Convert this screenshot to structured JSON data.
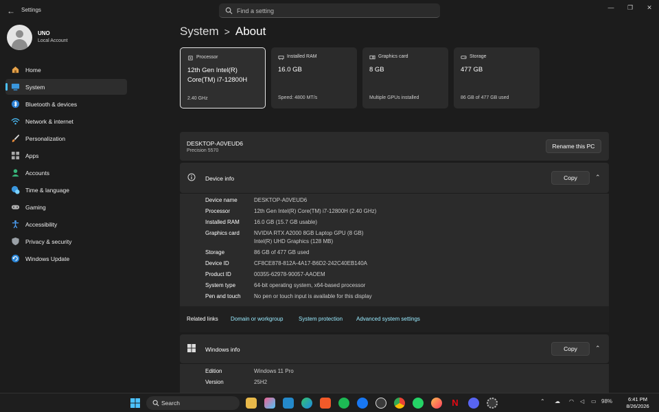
{
  "window": {
    "title": "Settings"
  },
  "search": {
    "placeholder": "Find a setting"
  },
  "user": {
    "name": "UNO",
    "account_type": "Local Account"
  },
  "sidebar": {
    "items": [
      {
        "label": "Home",
        "icon": "home-icon",
        "active": false
      },
      {
        "label": "System",
        "icon": "system-icon",
        "active": true
      },
      {
        "label": "Bluetooth & devices",
        "icon": "bluetooth-icon",
        "active": false
      },
      {
        "label": "Network & internet",
        "icon": "wifi-icon",
        "active": false
      },
      {
        "label": "Personalization",
        "icon": "brush-icon",
        "active": false
      },
      {
        "label": "Apps",
        "icon": "apps-icon",
        "active": false
      },
      {
        "label": "Accounts",
        "icon": "accounts-icon",
        "active": false
      },
      {
        "label": "Time & language",
        "icon": "globe-clock-icon",
        "active": false
      },
      {
        "label": "Gaming",
        "icon": "gamepad-icon",
        "active": false
      },
      {
        "label": "Accessibility",
        "icon": "accessibility-icon",
        "active": false
      },
      {
        "label": "Privacy & security",
        "icon": "shield-icon",
        "active": false
      },
      {
        "label": "Windows Update",
        "icon": "update-icon",
        "active": false
      }
    ]
  },
  "breadcrumb": {
    "parent": "System",
    "separator": ">",
    "current": "About"
  },
  "specs": [
    {
      "title": "Processor",
      "value": "12th Gen Intel(R) Core(TM) i7-12800H",
      "detail": "2.40 GHz",
      "icon": "processor-icon"
    },
    {
      "title": "Installed RAM",
      "value": "16.0 GB",
      "detail": "Speed: 4800 MT/s",
      "icon": "ram-icon"
    },
    {
      "title": "Graphics card",
      "value": "8 GB",
      "detail": "Multiple GPUs installed",
      "icon": "gpu-icon"
    },
    {
      "title": "Storage",
      "value": "477 GB",
      "detail": "86 GB of 477 GB used",
      "icon": "storage-icon"
    }
  ],
  "pc": {
    "name": "DESKTOP-A0VEUD6",
    "model": "Precision 5570",
    "rename_label": "Rename this PC"
  },
  "device_info": {
    "title": "Device info",
    "copy_label": "Copy",
    "rows": [
      {
        "key": "Device name",
        "value": "DESKTOP-A0VEUD6"
      },
      {
        "key": "Processor",
        "value": "12th Gen Intel(R) Core(TM) i7-12800H (2.40 GHz)"
      },
      {
        "key": "Installed RAM",
        "value": "16.0 GB (15.7 GB usable)"
      },
      {
        "key": "Graphics card",
        "value": "NVIDIA RTX A2000 8GB Laptop GPU (8 GB)",
        "value2": "Intel(R) UHD Graphics (128 MB)"
      },
      {
        "key": "Storage",
        "value": "86 GB of 477 GB used"
      },
      {
        "key": "Device ID",
        "value": "CF8CE878-812A-4A17-B6D2-242C40EB140A"
      },
      {
        "key": "Product ID",
        "value": "00355-62978-90057-AAOEM"
      },
      {
        "key": "System type",
        "value": "64-bit operating system, x64-based processor"
      },
      {
        "key": "Pen and touch",
        "value": "No pen or touch input is available for this display"
      }
    ]
  },
  "related": {
    "label": "Related links",
    "links": [
      "Domain or workgroup",
      "System protection",
      "Advanced system settings"
    ]
  },
  "windows_info": {
    "title": "Windows info",
    "copy_label": "Copy",
    "rows": [
      {
        "key": "Edition",
        "value": "Windows 11 Pro"
      },
      {
        "key": "Version",
        "value": "25H2"
      }
    ]
  },
  "taskbar": {
    "search_label": "Search",
    "apps": [
      "windows-start-icon",
      "file-explorer-icon",
      "photos-icon",
      "vscode-icon",
      "edge-icon",
      "brave-icon",
      "spotify-icon",
      "facebook-icon",
      "chatgpt-icon",
      "chrome-icon",
      "whatsapp-icon",
      "firefox-icon",
      "netflix-icon",
      "discord-icon",
      "settings-icon"
    ],
    "battery": "98%",
    "time": "6:41 PM",
    "date": "8/26/2026"
  },
  "colors": {
    "accent": "#4cc2ff",
    "link": "#99ebff",
    "background": "#1c1c1c",
    "card": "#2b2b2b"
  }
}
